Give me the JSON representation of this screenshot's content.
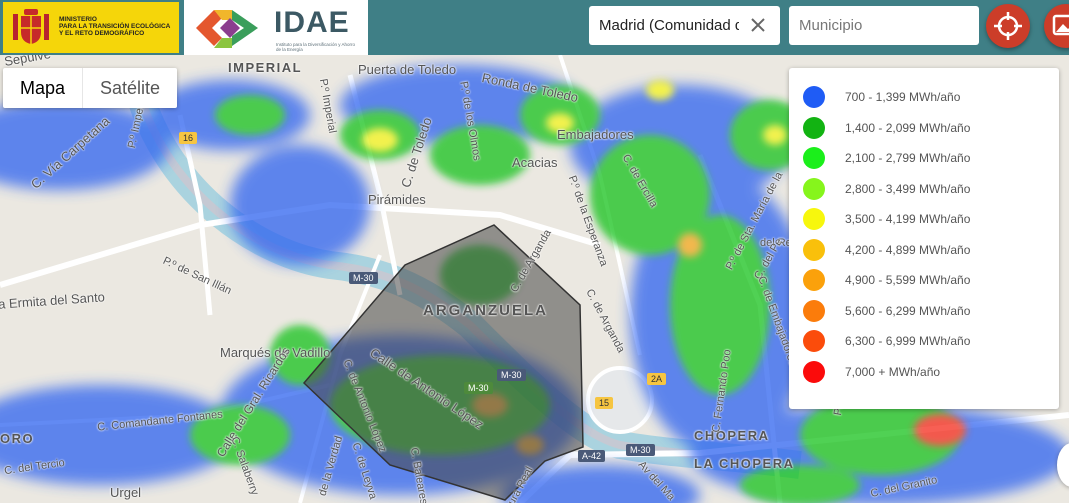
{
  "header": {
    "ministry_logo_text": [
      "MINISTERIO",
      "PARA LA TRANSICIÓN ECOLÓGICA",
      "Y EL RETO DEMOGRÁFICO"
    ],
    "idae_brand": "IDAE",
    "idae_subtitle": "Instituto para la Diversificación y Ahorro de la Energía",
    "region_value": "Madrid (Comunidad de",
    "municipio_placeholder": "Municipio",
    "locate_icon": "crosshair-icon",
    "image_icon": "image-icon"
  },
  "map_type": {
    "active": "Mapa",
    "inactive": "Satélite"
  },
  "legend": {
    "items": [
      {
        "label": "700 - 1,399 MWh/año",
        "color": "#1f5cf5"
      },
      {
        "label": "1,400 - 2,099 MWh/año",
        "color": "#12b312"
      },
      {
        "label": "2,100 - 2,799 MWh/año",
        "color": "#1bef1b"
      },
      {
        "label": "2,800 - 3,499 MWh/año",
        "color": "#86f51c"
      },
      {
        "label": "3,500 - 4,199 MWh/año",
        "color": "#f7f70d"
      },
      {
        "label": "4,200 - 4,899 MWh/año",
        "color": "#f9c00b"
      },
      {
        "label": "4,900 - 5,599 MWh/año",
        "color": "#fba10b"
      },
      {
        "label": "5,600 - 6,299 MWh/año",
        "color": "#fb7c0b"
      },
      {
        "label": "6,300 - 6,999 MWh/año",
        "color": "#fb4c0b"
      },
      {
        "label": "7,000 + MWh/año",
        "color": "#fb0b0b"
      }
    ]
  },
  "map_labels": {
    "imperial": "IMPERIAL",
    "arganzuela": "ARGANZUELA",
    "chopera": "CHOPERA",
    "la_chopera": "LA CHOPERA",
    "puerta_toledo": "Puerta de Toledo",
    "ronda_toledo": "Ronda de Toledo",
    "embajadores": "Embajadores",
    "acacias": "Acacias",
    "piramides": "Pirámides",
    "marques_vadillo": "Marqués de Vadillo",
    "ermita_santo": "a Ermita del Santo",
    "via_carpetana": "C. Vía Carpetana",
    "sepulveda": "Sepúlve",
    "po_imperial_1": "P.º Imperial",
    "po_imperial_2": "P.º Imperial",
    "c_toledo": "C. de Toledo",
    "po_olmos": "P.º de los Olmos",
    "c_ercilla": "C. de Ercilla",
    "po_esperanza": "P.º de la Esperanza",
    "c_arganda_1": "C. de Arganda",
    "c_arganda_2": "C. de Arganda",
    "po_san_illan": "P.º de San Illán",
    "calle_antonio_lopez": "Calle de Antonio López",
    "c_antonio_lopez": "C. de Antonio López",
    "gral_ricardos": "Calle del Gral. Ricardos",
    "comandante_fontanes": "C. Comandante Fontanes",
    "c_salaberry": "C. Salaberry",
    "la_verdad": "de la Verdad",
    "c_leyva": "C. de Leyva",
    "c_baleares": "C. Baleares",
    "c_tercio": "C. del Tercio",
    "urgel": "Urgel",
    "fernando_poo": "C. Fernando Poo",
    "po_sta_maria": "P.º de Sta. María de la",
    "av_manzanares": "Av del Ma",
    "c_granito": "C. del Granito",
    "del_real": "del Real",
    "del_pe": "C. del Pe",
    "oro": "ORO",
    "gra_real": "ura Real",
    "c_embajadores": "C. de Embajadores",
    "pas": "Pas",
    "m30_1": "M-30",
    "m30_2": "M-30",
    "m30_3": "M-30",
    "m30_4": "M-30",
    "a42": "A-42",
    "r16": "16",
    "r15": "15",
    "r2a": "2A"
  }
}
